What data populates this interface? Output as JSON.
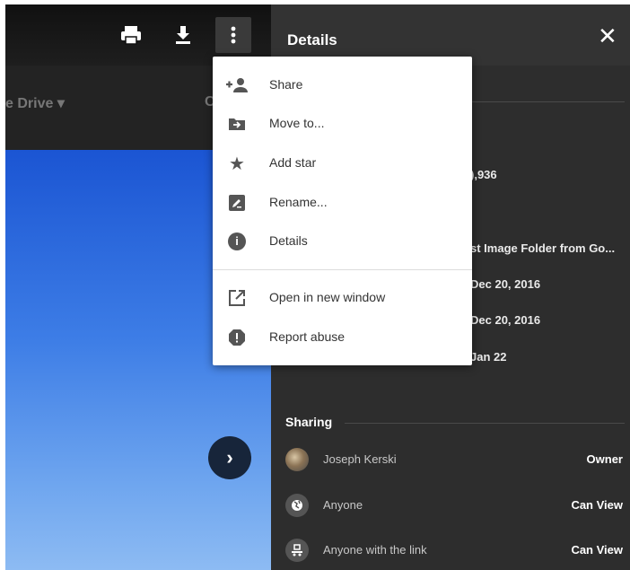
{
  "viewer": {
    "toolbar": {
      "print_icon": "print-icon",
      "download_icon": "download-icon",
      "more_icon": "more-vert-icon"
    },
    "drive_label": "e Drive ▾",
    "drive_label_right": "C"
  },
  "details_panel": {
    "title": "Details",
    "close_glyph": "✕",
    "values": [
      "),936",
      "st Image Folder from Go...",
      "Dec 20, 2016",
      "Dec 20, 2016",
      "Jan 22"
    ],
    "sharing": {
      "title": "Sharing",
      "people": [
        {
          "name": "Joseph Kerski",
          "role": "Owner",
          "icon": "avatar-photo"
        },
        {
          "name": "Anyone",
          "role": "Can View",
          "icon": "globe-icon"
        },
        {
          "name": "Anyone with the link",
          "role": "Can View",
          "icon": "link-icon"
        }
      ]
    }
  },
  "menu": {
    "items": [
      {
        "label": "Share",
        "icon": "person-add-icon"
      },
      {
        "label": "Move to...",
        "icon": "move-to-folder-icon"
      },
      {
        "label": "Add star",
        "icon": "star-icon"
      },
      {
        "label": "Rename...",
        "icon": "rename-icon"
      },
      {
        "label": "Details",
        "icon": "info-icon"
      },
      {
        "label": "Open in new window",
        "icon": "open-in-new-icon"
      },
      {
        "label": "Report abuse",
        "icon": "report-icon"
      }
    ]
  },
  "colors": {
    "panel_bg": "#2d2d2d",
    "menu_bg": "#ffffff",
    "image_top": "#1b55d3",
    "image_bottom": "#8dbbf3"
  }
}
